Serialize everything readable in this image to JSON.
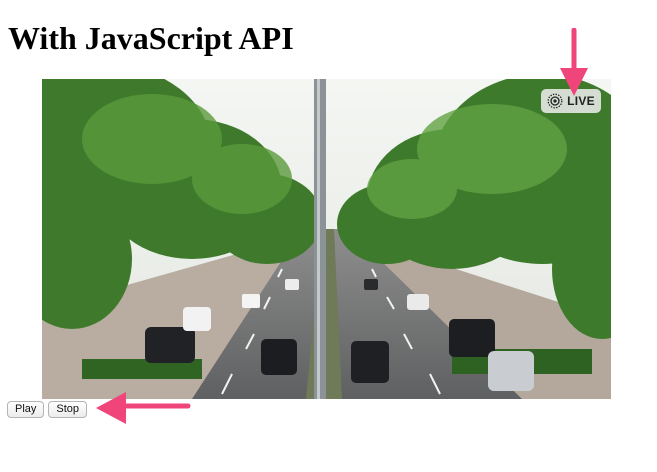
{
  "heading": "With JavaScript API",
  "live_photo": {
    "badge_label": "LIVE",
    "badge_icon": "live-photo-icon"
  },
  "controls": {
    "play_label": "Play",
    "stop_label": "Stop"
  },
  "annotations": {
    "arrow_color": "#f0457a"
  }
}
